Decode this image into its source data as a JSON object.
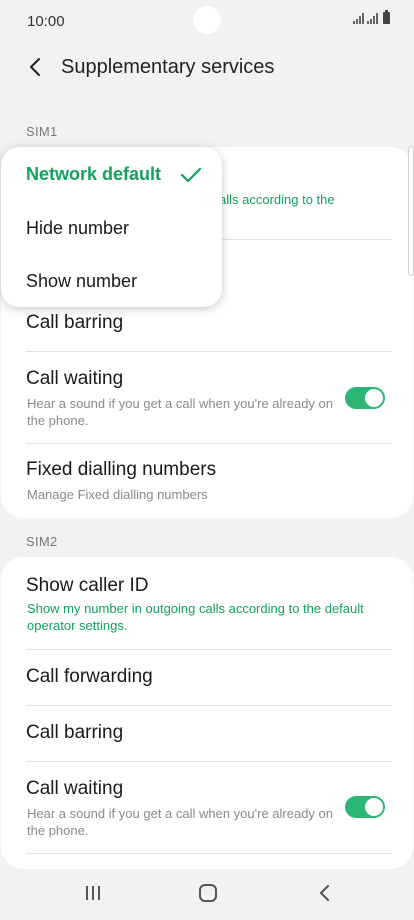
{
  "status_bar": {
    "time": "10:00"
  },
  "app_bar": {
    "title": "Supplementary services"
  },
  "sim1": {
    "label": "SIM1",
    "caller_id_sub_visible": "alls according to the",
    "call_barring": "Call barring",
    "call_waiting": {
      "title": "Call waiting",
      "sub": "Hear a sound if you get a call when you're already on the phone.",
      "enabled": true
    },
    "fixed_dialling": {
      "title": "Fixed dialling numbers",
      "sub": "Manage Fixed dialling numbers"
    }
  },
  "sim2": {
    "label": "SIM2",
    "caller_id": {
      "title": "Show caller ID",
      "sub": "Show my number in outgoing calls according to the default operator settings."
    },
    "call_forwarding": "Call forwarding",
    "call_barring": "Call barring",
    "call_waiting": {
      "title": "Call waiting",
      "sub": "Hear a sound if you get a call when you're already on the phone.",
      "enabled": true
    }
  },
  "popup": {
    "options": [
      "Network default",
      "Hide number",
      "Show number"
    ],
    "selected": "Network default"
  },
  "colors": {
    "accent": "#12a15f",
    "toggle_on": "#2bb673",
    "background": "#f2f2f2"
  }
}
